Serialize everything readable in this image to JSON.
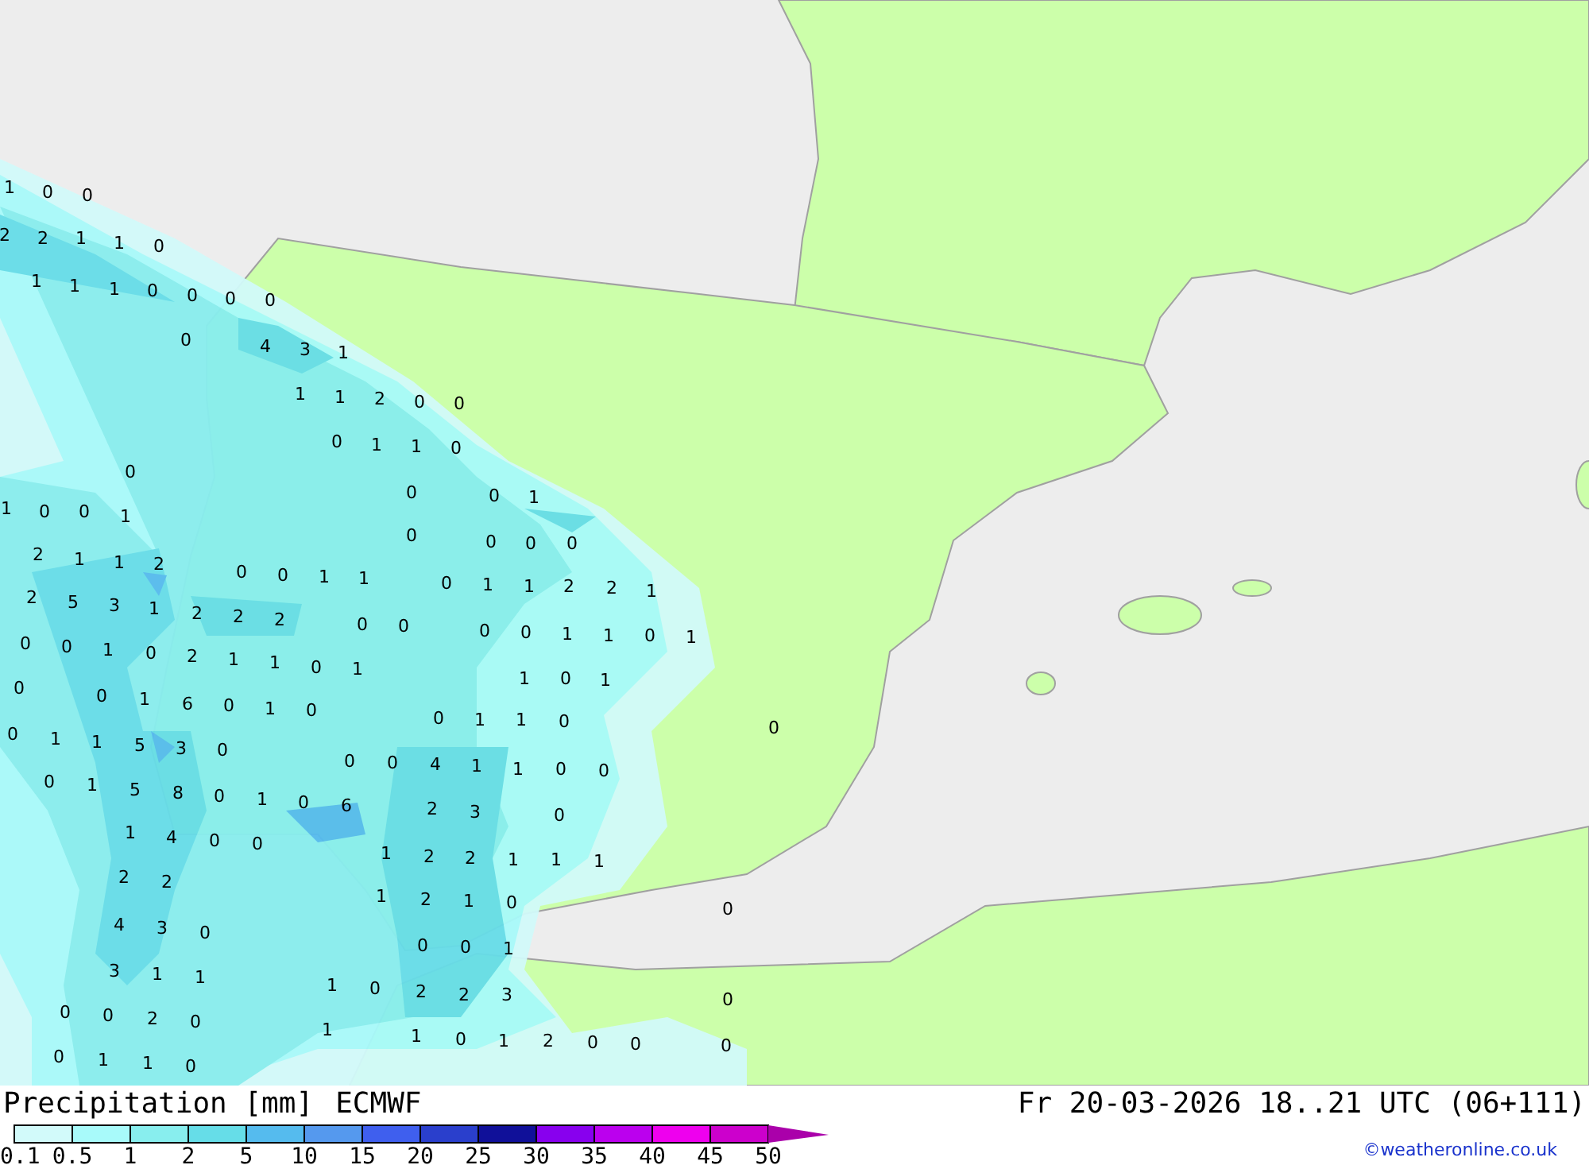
{
  "map": {
    "values": [
      "1",
      "0",
      "0",
      "2",
      "2",
      "1",
      "1",
      "0",
      "1",
      "1",
      "1",
      "0",
      "0",
      "0",
      "0",
      "0",
      "4",
      "3",
      "1",
      "1",
      "1",
      "2",
      "0",
      "0",
      "0",
      "1",
      "1",
      "0",
      "0",
      "0",
      "0",
      "1",
      "1",
      "0",
      "0",
      "1",
      "0",
      "0",
      "0",
      "0",
      "2",
      "1",
      "1",
      "2",
      "0",
      "0",
      "1",
      "1",
      "0",
      "1",
      "1",
      "2",
      "2",
      "1",
      "2",
      "5",
      "3",
      "1",
      "2",
      "2",
      "2",
      "0",
      "0",
      "0",
      "0",
      "1",
      "1",
      "0",
      "1",
      "0",
      "0",
      "1",
      "0",
      "2",
      "1",
      "1",
      "0",
      "1",
      "1",
      "0",
      "1",
      "0",
      "0",
      "1",
      "6",
      "0",
      "1",
      "0",
      "0",
      "1",
      "1",
      "0",
      "0",
      "0",
      "1",
      "1",
      "5",
      "3",
      "0",
      "0",
      "0",
      "4",
      "1",
      "1",
      "0",
      "0",
      "0",
      "1",
      "5",
      "8",
      "0",
      "1",
      "0",
      "6",
      "2",
      "3",
      "0",
      "1",
      "4",
      "0",
      "0",
      "1",
      "2",
      "2",
      "1",
      "1",
      "1",
      "2",
      "2",
      "1",
      "2",
      "1",
      "0",
      "0",
      "4",
      "3",
      "0",
      "0",
      "0",
      "1",
      "3",
      "1",
      "1",
      "1",
      "0",
      "2",
      "2",
      "3",
      "0",
      "0",
      "0",
      "2",
      "0",
      "1",
      "1",
      "0",
      "1",
      "2",
      "0",
      "0",
      "0",
      "0",
      "1",
      "1",
      "0"
    ]
  },
  "legend": {
    "title": "Precipitation [mm]",
    "model": "ECMWF",
    "valid_time": "Fr 20-03-2026 18..21 UTC (06+111)",
    "segments": [
      {
        "color": "#d2fafa"
      },
      {
        "color": "#a8fafa"
      },
      {
        "color": "#88eeee"
      },
      {
        "color": "#66dde8"
      },
      {
        "color": "#55bbee"
      },
      {
        "color": "#5599ee"
      },
      {
        "color": "#3f5fee"
      },
      {
        "color": "#2a3fcc"
      },
      {
        "color": "#101099"
      },
      {
        "color": "#8800ee"
      },
      {
        "color": "#bb00ee"
      },
      {
        "color": "#ee00ee"
      },
      {
        "color": "#cc00cc"
      }
    ],
    "labels": [
      "0.1",
      "0.5",
      "1",
      "2",
      "5",
      "10",
      "15",
      "20",
      "25",
      "30",
      "35",
      "40",
      "45",
      "50"
    ],
    "credit": "©weatheronline.co.uk"
  }
}
